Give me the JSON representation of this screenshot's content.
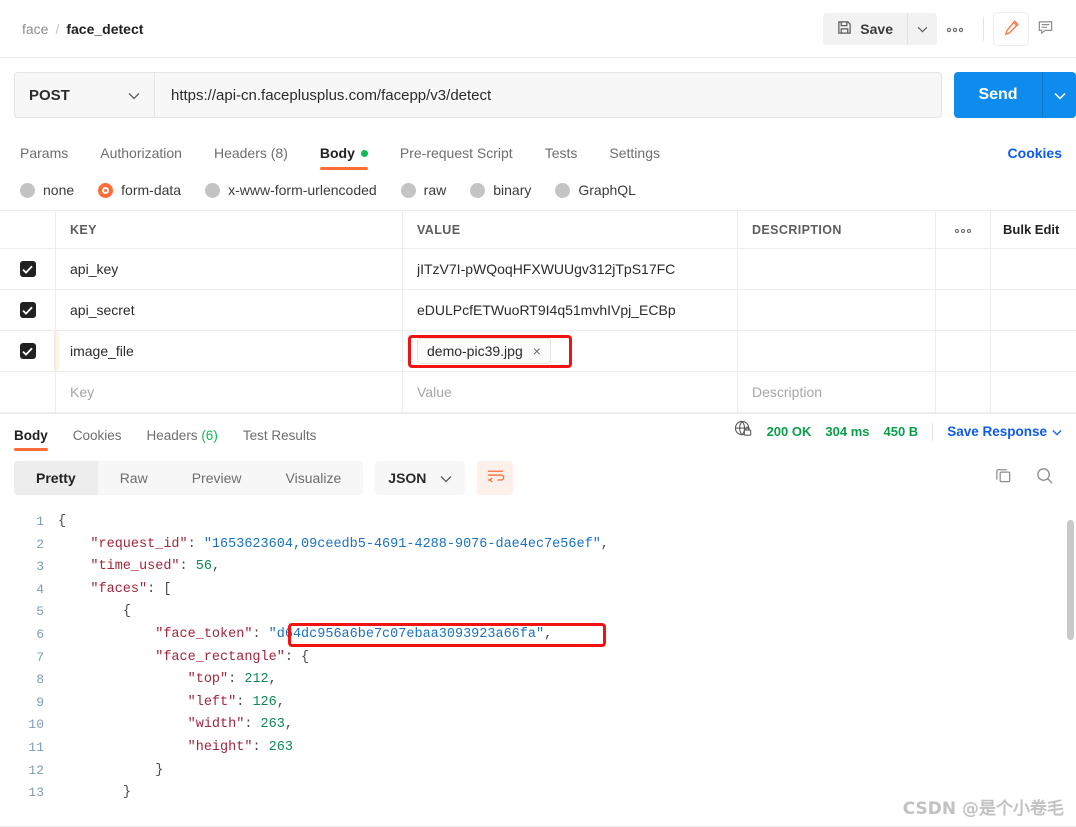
{
  "header": {
    "breadcrumb_parent": "face",
    "breadcrumb_sep": "/",
    "breadcrumb_current": "face_detect",
    "save_label": "Save",
    "more_label": "●●●"
  },
  "request": {
    "method": "POST",
    "url": "https://api-cn.faceplusplus.com/facepp/v3/detect",
    "send_label": "Send"
  },
  "request_tabs": [
    {
      "label": "Params",
      "active": false
    },
    {
      "label": "Authorization",
      "active": false
    },
    {
      "label": "Headers (8)",
      "active": false
    },
    {
      "label": "Body",
      "active": true,
      "dot": true
    },
    {
      "label": "Pre-request Script",
      "active": false
    },
    {
      "label": "Tests",
      "active": false
    },
    {
      "label": "Settings",
      "active": false
    }
  ],
  "cookies_link": "Cookies",
  "body_types": [
    {
      "label": "none",
      "selected": false
    },
    {
      "label": "form-data",
      "selected": true
    },
    {
      "label": "x-www-form-urlencoded",
      "selected": false
    },
    {
      "label": "raw",
      "selected": false
    },
    {
      "label": "binary",
      "selected": false
    },
    {
      "label": "GraphQL",
      "selected": false
    }
  ],
  "table": {
    "headers": {
      "key": "KEY",
      "value": "VALUE",
      "description": "DESCRIPTION",
      "bulk_edit": "Bulk Edit",
      "dots": "●●●"
    },
    "rows": [
      {
        "checked": true,
        "key": "api_key",
        "value": "jITzV7I-pWQoqHFXWUUgv312jTpS17FC",
        "description": "",
        "is_file": false
      },
      {
        "checked": true,
        "key": "api_secret",
        "value": "eDULPcfETWuoRT9I4q51mvhIVpj_ECBp",
        "description": "",
        "is_file": false
      },
      {
        "checked": true,
        "key": "image_file",
        "value": "demo-pic39.jpg",
        "description": "",
        "is_file": true,
        "chip_close": "×",
        "highlighted": true
      }
    ],
    "placeholder_row": {
      "key": "Key",
      "value": "Value",
      "description": "Description"
    }
  },
  "response": {
    "tabs": [
      {
        "label": "Body",
        "active": true
      },
      {
        "label": "Cookies",
        "active": false
      },
      {
        "label": "Headers",
        "count": " (6)",
        "active": false
      },
      {
        "label": "Test Results",
        "active": false
      }
    ],
    "status": "200 OK",
    "time": "304 ms",
    "size": "450 B",
    "save_response": "Save Response",
    "view_modes": [
      {
        "label": "Pretty",
        "active": true
      },
      {
        "label": "Raw",
        "active": false
      },
      {
        "label": "Preview",
        "active": false
      },
      {
        "label": "Visualize",
        "active": false
      }
    ],
    "format": "JSON"
  },
  "code": {
    "lines": [
      {
        "n": "1",
        "indent": 0,
        "tokens": [
          {
            "t": "pun",
            "v": "{"
          }
        ]
      },
      {
        "n": "2",
        "indent": 1,
        "tokens": [
          {
            "t": "key",
            "v": "\"request_id\""
          },
          {
            "t": "pun",
            "v": ": "
          },
          {
            "t": "str",
            "v": "\"1653623604,09ceedb5-4691-4288-9076-dae4ec7e56ef\""
          },
          {
            "t": "pun",
            "v": ","
          }
        ]
      },
      {
        "n": "3",
        "indent": 1,
        "tokens": [
          {
            "t": "key",
            "v": "\"time_used\""
          },
          {
            "t": "pun",
            "v": ": "
          },
          {
            "t": "num",
            "v": "56"
          },
          {
            "t": "pun",
            "v": ","
          }
        ]
      },
      {
        "n": "4",
        "indent": 1,
        "tokens": [
          {
            "t": "key",
            "v": "\"faces\""
          },
          {
            "t": "pun",
            "v": ": ["
          }
        ]
      },
      {
        "n": "5",
        "indent": 2,
        "tokens": [
          {
            "t": "pun",
            "v": "{"
          }
        ]
      },
      {
        "n": "6",
        "indent": 3,
        "tokens": [
          {
            "t": "key",
            "v": "\"face_token\""
          },
          {
            "t": "pun",
            "v": ": "
          },
          {
            "t": "str",
            "v": "\"d64dc956a6be7c07ebaa3093923a66fa\""
          },
          {
            "t": "pun",
            "v": ","
          }
        ],
        "highlight": true
      },
      {
        "n": "7",
        "indent": 3,
        "tokens": [
          {
            "t": "key",
            "v": "\"face_rectangle\""
          },
          {
            "t": "pun",
            "v": ": {"
          }
        ]
      },
      {
        "n": "8",
        "indent": 4,
        "tokens": [
          {
            "t": "key",
            "v": "\"top\""
          },
          {
            "t": "pun",
            "v": ": "
          },
          {
            "t": "num",
            "v": "212"
          },
          {
            "t": "pun",
            "v": ","
          }
        ]
      },
      {
        "n": "9",
        "indent": 4,
        "tokens": [
          {
            "t": "key",
            "v": "\"left\""
          },
          {
            "t": "pun",
            "v": ": "
          },
          {
            "t": "num",
            "v": "126"
          },
          {
            "t": "pun",
            "v": ","
          }
        ]
      },
      {
        "n": "10",
        "indent": 4,
        "tokens": [
          {
            "t": "key",
            "v": "\"width\""
          },
          {
            "t": "pun",
            "v": ": "
          },
          {
            "t": "num",
            "v": "263"
          },
          {
            "t": "pun",
            "v": ","
          }
        ]
      },
      {
        "n": "11",
        "indent": 4,
        "tokens": [
          {
            "t": "key",
            "v": "\"height\""
          },
          {
            "t": "pun",
            "v": ": "
          },
          {
            "t": "num",
            "v": "263"
          }
        ]
      },
      {
        "n": "12",
        "indent": 3,
        "tokens": [
          {
            "t": "pun",
            "v": "}"
          }
        ]
      },
      {
        "n": "13",
        "indent": 2,
        "tokens": [
          {
            "t": "pun",
            "v": "}"
          }
        ]
      }
    ]
  },
  "watermark": "CSDN @是个小卷毛",
  "colors": {
    "accent": "#ff6c37",
    "send": "#0d8ced",
    "link": "#0d5aef",
    "success": "#0a9e4a",
    "highlight_box": "#f21212"
  }
}
